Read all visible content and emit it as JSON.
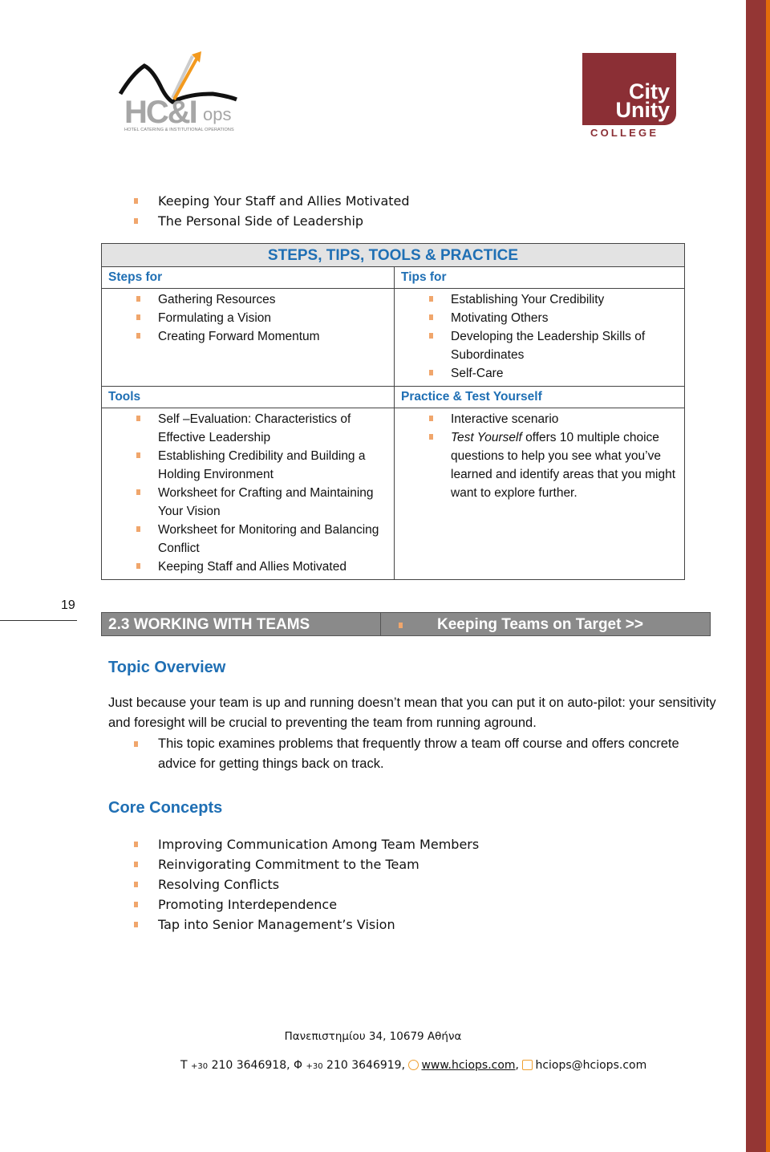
{
  "logos": {
    "hci": {
      "name": "HC&I",
      "suffix": "ops",
      "tagline": "HOTEL CATERING & INSTITUTIONAL OPERATIONS"
    },
    "college": {
      "line1": "City",
      "line2": "Unity",
      "line3": "COLLEGE",
      "brand_color": "#8b2f35"
    }
  },
  "intro_list": [
    "Keeping Your Staff and Allies Motivated",
    "The Personal Side of Leadership"
  ],
  "table": {
    "title": "STEPS, TIPS, TOOLS & PRACTICE",
    "steps": {
      "label": "Steps for",
      "items": [
        "Gathering Resources",
        "Formulating a Vision",
        "Creating Forward Momentum"
      ]
    },
    "tips": {
      "label": "Tips for",
      "items": [
        "Establishing Your Credibility",
        "Motivating Others",
        "Developing the Leadership Skills of Subordinates",
        "Self-Care"
      ]
    },
    "tools": {
      "label": "Tools",
      "items": [
        "Self –Evaluation: Characteristics of Effective Leadership",
        "Establishing Credibility and Building a Holding Environment",
        "Worksheet for Crafting and Maintaining Your Vision",
        "Worksheet for Monitoring and Balancing Conflict",
        "Keeping Staff and Allies Motivated"
      ]
    },
    "practice": {
      "label": "Practice & Test Yourself",
      "item1": "Interactive scenario",
      "item2_italic": "Test Yourself",
      "item2_rest": " offers 10 multiple choice questions to help you see what you’ve learned and identify areas that you might want to explore further."
    }
  },
  "page_number": "19",
  "section": {
    "left": "2.3 WORKING WITH TEAMS",
    "right": "Keeping Teams on Target >>"
  },
  "overview": {
    "heading": "Topic Overview",
    "paragraph": "Just because your team is up and running doesn’t mean that you can put it on auto-pilot: your sensitivity and foresight will be crucial to preventing the team from running aground.",
    "bullet": "This topic examines problems that frequently throw a team off course and offers concrete advice for getting things back on track."
  },
  "core": {
    "heading": "Core Concepts",
    "items": [
      "Improving Communication Among Team Members",
      "Reinvigorating Commitment to the Team",
      "Resolving Conflicts",
      "Promoting Interdependence",
      "Tap into Senior Management’s Vision"
    ]
  },
  "footer": {
    "address": "Πανεπιστημίου 34, 10679 Αθήνα",
    "phone_prefix": "T",
    "phone_cc": "+30",
    "phone": " 210 3646918, ",
    "fax_prefix": "Φ",
    "fax_cc": "+30",
    "fax": " 210 3646919, ",
    "website": "www.hciops.com",
    "email": "hciops@hciops.com"
  },
  "colors": {
    "heading_blue": "#1f6fb4",
    "bullet_orange": "#f0a66c",
    "side_band": "#943634",
    "side_strip": "#e36c0a"
  }
}
